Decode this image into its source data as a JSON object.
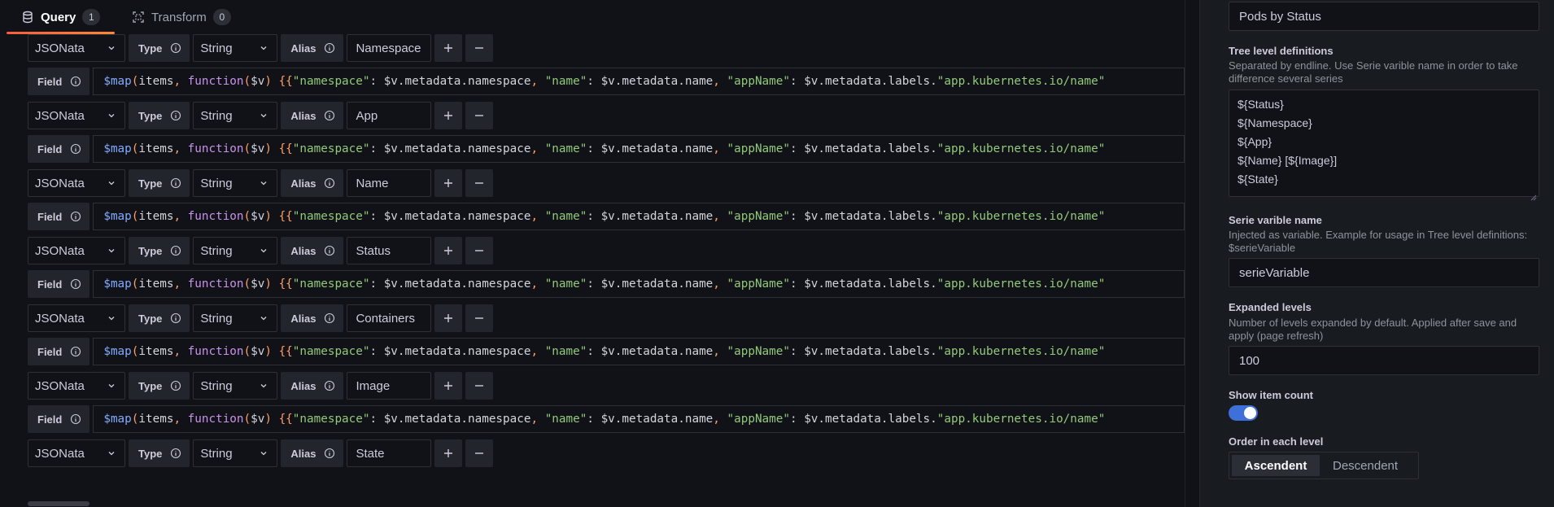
{
  "tabs": [
    {
      "label": "Query",
      "count": "1"
    },
    {
      "label": "Transform",
      "count": "0"
    }
  ],
  "labels": {
    "type": "Type",
    "alias": "Alias",
    "field": "Field"
  },
  "queries": [
    {
      "parser": "JSONata",
      "type": "String",
      "alias": "Namespace"
    },
    {
      "parser": "JSONata",
      "type": "String",
      "alias": "App"
    },
    {
      "parser": "JSONata",
      "type": "String",
      "alias": "Name"
    },
    {
      "parser": "JSONata",
      "type": "String",
      "alias": "Status"
    },
    {
      "parser": "JSONata",
      "type": "String",
      "alias": "Containers"
    },
    {
      "parser": "JSONata",
      "type": "String",
      "alias": "Image"
    },
    {
      "parser": "JSONata",
      "type": "String",
      "alias": "State"
    }
  ],
  "field_code": {
    "fn": "$map",
    "p1": "(",
    "arg1": "items",
    "comma1": ", ",
    "kw": "function",
    "p2": "(",
    "param": "$v",
    "p3": ")",
    "brace": " {{",
    "k1": "\"namespace\"",
    "colon1": ": ",
    "v1": "$v.metadata.namespace",
    "comma2": ", ",
    "k2": "\"name\"",
    "colon2": ": ",
    "v2": "$v.metadata.name",
    "comma3": ", ",
    "k3": "\"appName\"",
    "colon3": ": ",
    "v3": "$v.metadata.labels.",
    "k4": "\"app.kubernetes.io/name\""
  },
  "options": {
    "title_value": "Pods by Status",
    "tree_levels": {
      "title": "Tree level definitions",
      "description": "Separated by endline. Use Serie varible name in order to take difference several series",
      "lines": [
        "${Status}",
        "${Namespace}",
        "${App}",
        "${Name} [${Image}]",
        "${State}"
      ]
    },
    "serie_var": {
      "title": "Serie varible name",
      "description": "Injected as variable. Example for usage in Tree level definitions: $serieVariable",
      "value": "serieVariable"
    },
    "expanded": {
      "title": "Expanded levels",
      "description": "Number of levels expanded by default. Applied after save and apply (page refresh)",
      "value": "100"
    },
    "show_count": {
      "title": "Show item count",
      "enabled": true
    },
    "order": {
      "title": "Order in each level",
      "options": [
        "Ascendent",
        "Descendent"
      ],
      "selected": "Ascendent"
    }
  },
  "colors": {
    "accent_orange": "#f55f3e",
    "toggle_blue": "#3d71d9",
    "string_green": "#92c97a",
    "function_blue": "#82aaff",
    "keyword_purple": "#c792ea"
  }
}
